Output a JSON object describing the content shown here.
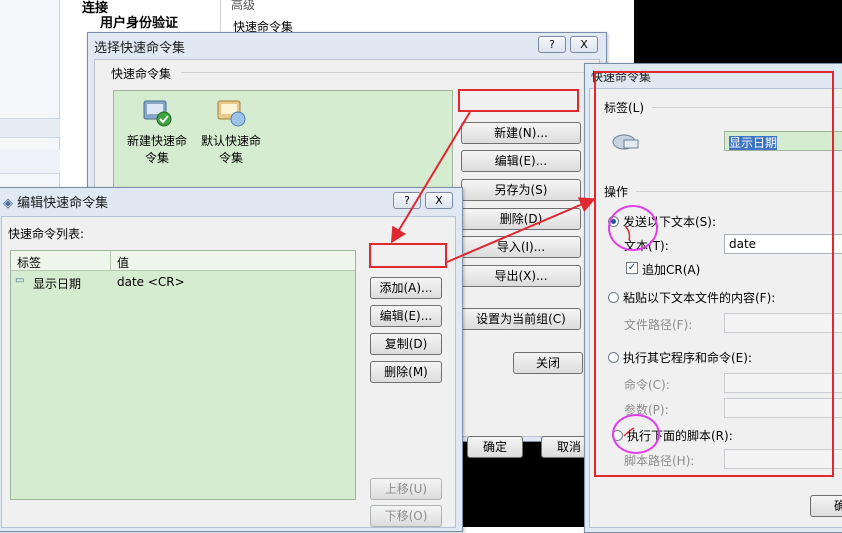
{
  "background": {
    "tree_connection": "连接",
    "tree_auth": "用户身份验证",
    "tree_sub": "...",
    "right_header": "高级",
    "right_item": "快速命令集"
  },
  "select_dialog": {
    "title": "选择快速命令集",
    "group_label": "快速命令集",
    "items": [
      {
        "label_line1": "新建快速命",
        "label_line2": "令集"
      },
      {
        "label_line1": "默认快速命",
        "label_line2": "令集"
      }
    ],
    "buttons": {
      "new": "新建(N)...",
      "edit": "编辑(E)...",
      "save_as": "另存为(S)",
      "delete": "删除(D)",
      "import": "导入(I)...",
      "export": "导出(X)...",
      "set_current": "设置为当前组(C)",
      "close": "关闭",
      "ok": "确定",
      "cancel": "取消"
    },
    "help": "?",
    "close_x": "X"
  },
  "edit_dialog": {
    "title": "编辑快速命令集",
    "list_label": "快速命令列表:",
    "columns": [
      "标签",
      "值"
    ],
    "rows": [
      {
        "label": "显示日期",
        "value": "date <CR>"
      }
    ],
    "buttons": {
      "add": "添加(A)...",
      "edit": "编辑(E)...",
      "copy": "复制(D)",
      "delete": "删除(M)",
      "move_up": "上移(U)",
      "move_down": "下移(O)"
    },
    "help": "?",
    "close_x": "X"
  },
  "command_dialog": {
    "title": "快速命令集",
    "label_section": "标签(L)",
    "label_value": "显示日期",
    "action_section": "操作",
    "opt_send_text": "发送以下文本(S):",
    "text_label": "文本(T):",
    "text_value": "date",
    "append_cr": "追加CR(A)",
    "opt_paste_file": "粘贴以下文本文件的内容(F):",
    "file_path_label": "文件路径(F):",
    "opt_run_program": "执行其它程序和命令(E):",
    "command_label": "命令(C):",
    "params_label": "参数(P):",
    "opt_run_script": "执行下面的脚本(R):",
    "script_path_label": "脚本路径(H):",
    "ok_partial": "确"
  },
  "colors": {
    "annotation_red": "#e0282f",
    "annotation_magenta": "#e13ee7",
    "list_green": "#d6ecd0"
  }
}
